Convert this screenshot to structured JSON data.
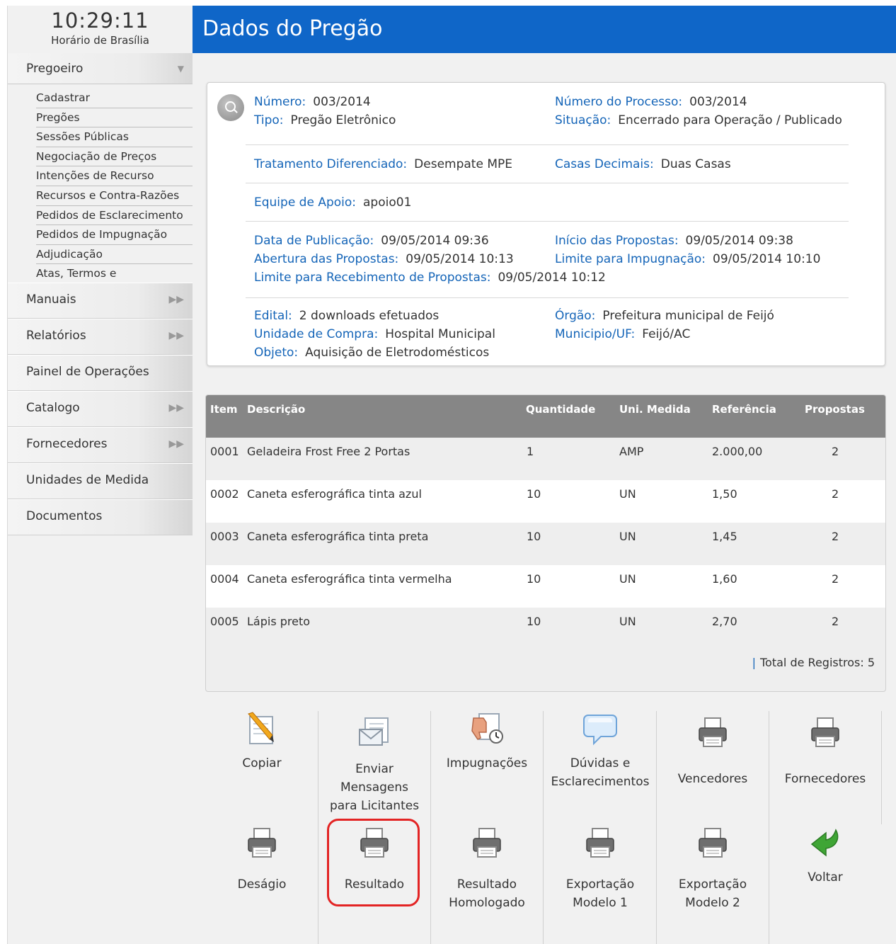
{
  "clock": {
    "time": "10:29:11",
    "timezone": "Horário de Brasília"
  },
  "sidebar": {
    "pregoeiro": {
      "label": "Pregoeiro",
      "items": [
        "Cadastrar",
        "Pregões",
        "Sessões Públicas",
        "Negociação de Preços",
        "Intenções de Recurso",
        "Recursos e Contra-Razões",
        "Pedidos de Esclarecimento",
        "Pedidos de Impugnação",
        "Adjudicação",
        "Atas, Termos e"
      ]
    },
    "menus": [
      "Manuais",
      "Relatórios",
      "Painel de Operações",
      "Catalogo",
      "Fornecedores",
      "Unidades de Medida",
      "Documentos"
    ]
  },
  "page": {
    "title": "Dados do Pregão"
  },
  "info": {
    "numero": {
      "label": "Número:",
      "value": "003/2014"
    },
    "processo": {
      "label": "Número do Processo:",
      "value": "003/2014"
    },
    "tipo": {
      "label": "Tipo:",
      "value": "Pregão Eletrônico"
    },
    "situacao": {
      "label": "Situação:",
      "value": "Encerrado para Operação / Publicado"
    },
    "tratamento": {
      "label": "Tratamento Diferenciado:",
      "value": "Desempate MPE"
    },
    "casas": {
      "label": "Casas Decimais:",
      "value": "Duas Casas"
    },
    "equipe": {
      "label": "Equipe de Apoio:",
      "value": "apoio01"
    },
    "publicacao": {
      "label": "Data de Publicação:",
      "value": "09/05/2014 09:36"
    },
    "inicio": {
      "label": "Início das Propostas:",
      "value": "09/05/2014 09:38"
    },
    "abertura": {
      "label": "Abertura das Propostas:",
      "value": "09/05/2014 10:13"
    },
    "impugnacao": {
      "label": "Limite para Impugnação:",
      "value": "09/05/2014 10:10"
    },
    "recebimento": {
      "label": "Limite para Recebimento de Propostas:",
      "value": "09/05/2014 10:12"
    },
    "edital": {
      "label": "Edital:",
      "value": "2 downloads efetuados"
    },
    "orgao": {
      "label": "Órgão:",
      "value": "Prefeitura municipal de Feijó"
    },
    "unidade": {
      "label": "Unidade de Compra:",
      "value": "Hospital Municipal"
    },
    "municipio": {
      "label": "Municipio/UF:",
      "value": "Feijó/AC"
    },
    "objeto": {
      "label": "Objeto:",
      "value": "Aquisição de Eletrodomésticos"
    }
  },
  "table": {
    "headers": [
      "Item",
      "Descrição",
      "Quantidade",
      "Uni. Medida",
      "Referência",
      "Propostas"
    ],
    "rows": [
      [
        "0001",
        "Geladeira Frost Free 2 Portas",
        "1",
        "AMP",
        "2.000,00",
        "2"
      ],
      [
        "0002",
        "Caneta esferográfica tinta azul",
        "10",
        "UN",
        "1,50",
        "2"
      ],
      [
        "0003",
        "Caneta esferográfica tinta preta",
        "10",
        "UN",
        "1,45",
        "2"
      ],
      [
        "0004",
        "Caneta esferográfica tinta vermelha",
        "10",
        "UN",
        "1,60",
        "2"
      ],
      [
        "0005",
        "Lápis preto",
        "10",
        "UN",
        "2,70",
        "2"
      ]
    ],
    "total_label": "Total de Registros: 5"
  },
  "actions": {
    "copiar": "Copiar",
    "enviar": [
      "Enviar",
      "Mensagens",
      "para Licitantes"
    ],
    "impugnacoes": "Impugnações",
    "duvidas": [
      "Dúvidas e",
      "Esclarecimentos"
    ],
    "vencedores": "Vencedores",
    "fornecedores": "Fornecedores",
    "desagio": "Deságio",
    "resultado": "Resultado",
    "homologado": [
      "Resultado",
      "Homologado"
    ],
    "modelo1": [
      "Exportação",
      "Modelo 1"
    ],
    "modelo2": [
      "Exportação",
      "Modelo 2"
    ],
    "voltar": "Voltar"
  },
  "colors": {
    "title_bar": "#0f66c8",
    "label_blue": "#1565b8",
    "highlight": "#e32424",
    "header_grey": "#868686",
    "voltar_green": "#3fa535"
  }
}
